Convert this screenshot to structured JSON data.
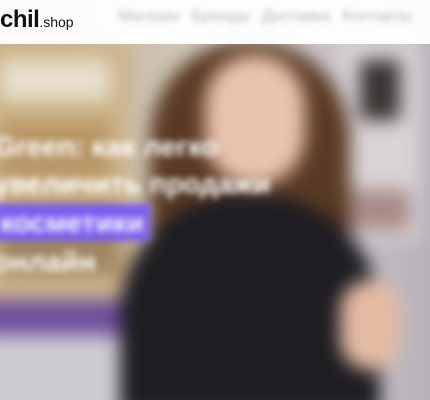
{
  "header": {
    "logo_main": "chil",
    "logo_suffix": ".shop",
    "nav": [
      "Магазин",
      "Бренды",
      "Доставка",
      "Контакты"
    ]
  },
  "hero": {
    "line1": "Green: как легко",
    "line2": "увеличить продажи",
    "highlight": "косметики",
    "line4": "онлайн"
  },
  "colors": {
    "accent": "#7a5df0",
    "header_bg": "#ffffff",
    "hero_text": "#ffffff"
  }
}
